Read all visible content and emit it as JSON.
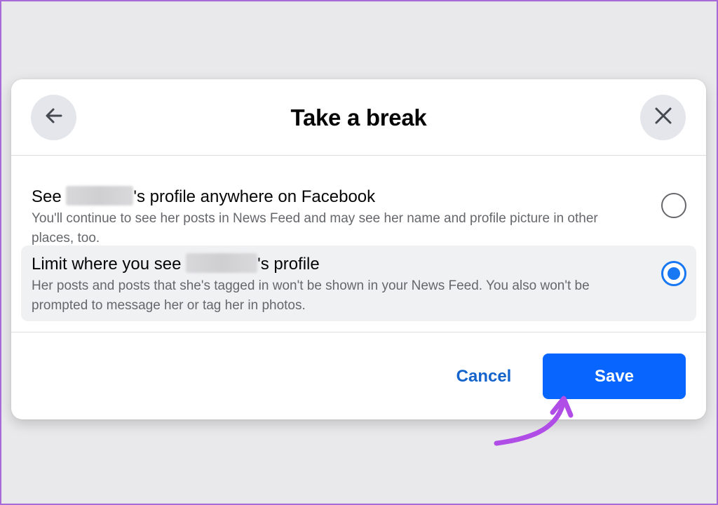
{
  "dialog": {
    "title": "Take a break",
    "back_icon": "arrow-left-icon",
    "close_icon": "close-icon"
  },
  "options": [
    {
      "title_prefix": "See ",
      "title_suffix": "'s profile anywhere on Facebook",
      "description": "You'll continue to see her posts in News Feed and may see her name and profile picture in other places, too.",
      "selected": false
    },
    {
      "title_prefix": "Limit where you see ",
      "title_suffix": "'s profile",
      "description": "Her posts and posts that she's tagged in won't be shown in your News Feed. You also won't be prompted to message her or tag her in photos.",
      "selected": true
    }
  ],
  "footer": {
    "cancel_label": "Cancel",
    "save_label": "Save"
  },
  "colors": {
    "accent": "#0866ff",
    "link": "#1464cc",
    "annotation_arrow": "#b04de6",
    "frame_border": "#a86ad6"
  }
}
